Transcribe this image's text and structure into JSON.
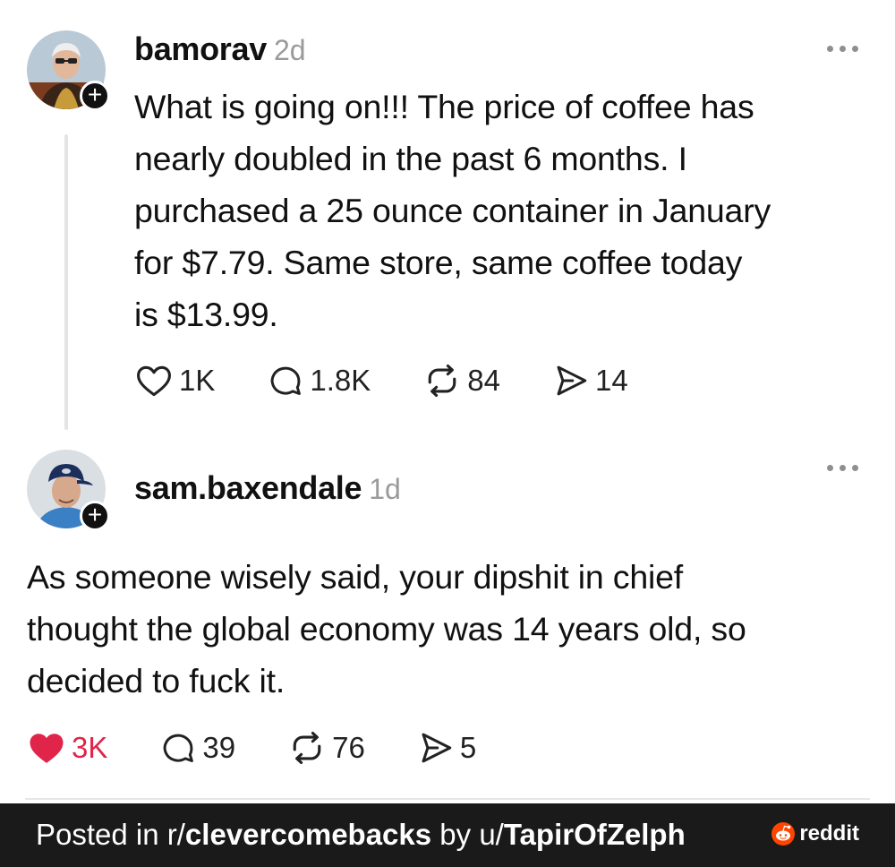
{
  "colors": {
    "like_active": "#e0244a",
    "text_primary": "#111111",
    "text_muted": "#9a9a9a",
    "footer_bg": "#1a1a1b",
    "reddit_orange": "#ff4500"
  },
  "posts": [
    {
      "username": "bamorav",
      "timestamp": "2d",
      "text_lines": [
        "What is going on!!! The price of coffee has",
        "nearly doubled in the past 6 months.  I",
        "purchased a 25 ounce container in January",
        "for $7.79.  Same store, same coffee today",
        "is $13.99."
      ],
      "liked": false,
      "stats": {
        "likes": "1K",
        "replies": "1.8K",
        "reposts": "84",
        "shares": "14"
      },
      "icons": {
        "more": "more-dots-icon",
        "like": "heart-outline-icon",
        "reply": "comment-icon",
        "repost": "repost-icon",
        "share": "send-icon",
        "follow": "plus-icon"
      }
    },
    {
      "username": "sam.baxendale",
      "timestamp": "1d",
      "text_lines": [
        "As someone wisely said, your dipshit in chief",
        "thought the global economy was 14 years old, so",
        "decided to fuck it."
      ],
      "liked": true,
      "stats": {
        "likes": "3K",
        "replies": "39",
        "reposts": "76",
        "shares": "5"
      },
      "icons": {
        "more": "more-dots-icon",
        "like": "heart-filled-icon",
        "reply": "comment-icon",
        "repost": "repost-icon",
        "share": "send-icon",
        "follow": "plus-icon"
      }
    }
  ],
  "footer": {
    "prefix": "Posted in r/",
    "subreddit": "clevercomebacks",
    "by_text": " by u/",
    "user": "TapirOfZelph",
    "brand": "reddit",
    "brand_icon": "reddit-alien-icon"
  }
}
